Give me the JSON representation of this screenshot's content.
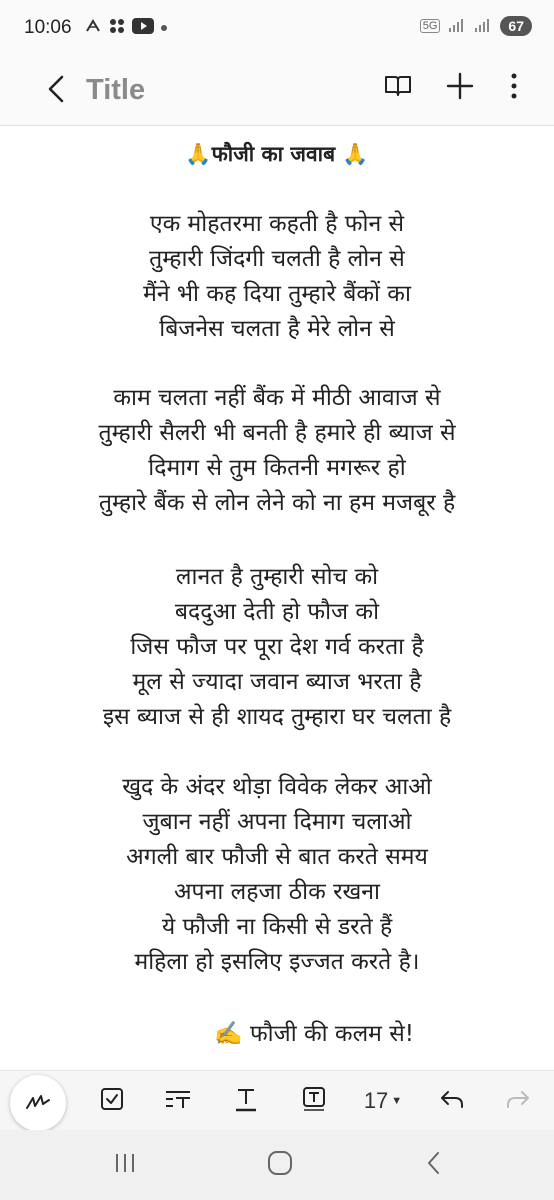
{
  "status_bar": {
    "time": "10:06",
    "network": "5G",
    "battery": "67"
  },
  "app_bar": {
    "title": "Title"
  },
  "note": {
    "heading": "🙏फौजी का जवाब 🙏",
    "lines": [
      "एक मोहतरमा कहती है फोन से",
      "तुम्हारी जिंदगी चलती है लोन से",
      "मैंने भी कह दिया तुम्हारे बैंकों का",
      "बिजनेस चलता है मेरे लोन से",
      "काम चलता नहीं बैंक में मीठी आवाज से",
      "तुम्हारी सैलरी भी बनती है हमारे ही ब्याज से",
      "दिमाग से तुम कितनी मगरूर हो",
      "तुम्हारे बैंक से लोन लेने को ना हम मजबूर है",
      "लानत है तुम्हारी सोच को",
      "बददुआ देती हो फौज को",
      "जिस फौज पर पूरा देश गर्व करता है",
      "मूल से ज्यादा जवान ब्याज भरता है",
      "इस ब्याज से ही शायद तुम्हारा घर चलता है",
      "खुद के अंदर थोड़ा विवेक लेकर आओ",
      "जुबान नहीं अपना दिमाग चलाओ",
      "अगली बार फौजी से बात करते समय",
      "अपना लहजा ठीक रखना",
      "ये फौजी ना किसी से डरते हैं",
      "महिला हो इसलिए  इज्जत करते है।"
    ],
    "signature": "✍️ फौजी की कलम से!"
  },
  "toolbar": {
    "font_size": "17"
  },
  "colors": {
    "background": "#fafafa",
    "note_background": "#ffffff",
    "title_color": "#8a8a8a",
    "text_color": "#222222"
  }
}
